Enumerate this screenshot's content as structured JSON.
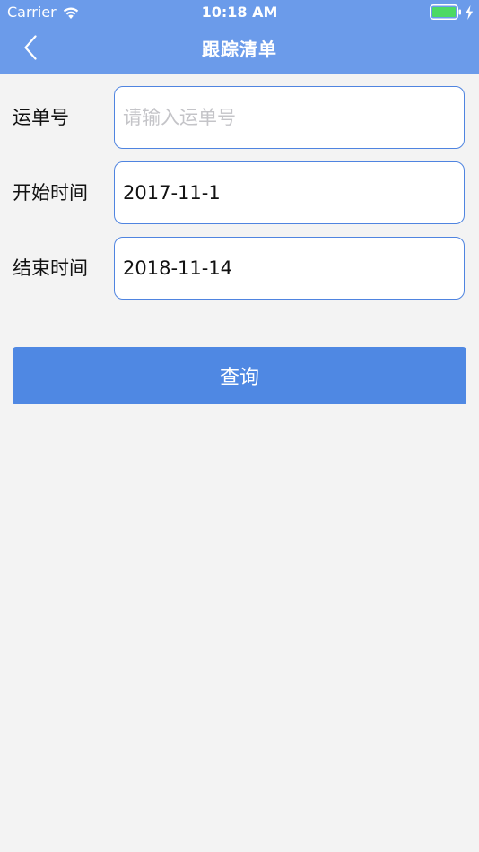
{
  "status_bar": {
    "carrier": "Carrier",
    "time": "10:18 AM",
    "wifi_icon": "wifi-icon",
    "battery_icon": "battery-icon",
    "charging_icon": "bolt-icon"
  },
  "nav": {
    "title": "跟踪清单",
    "back_icon": "chevron-left-icon"
  },
  "form": {
    "waybill": {
      "label": "运单号",
      "value": "",
      "placeholder": "请输入运单号"
    },
    "start_time": {
      "label": "开始时间",
      "value": "2017-11-1"
    },
    "end_time": {
      "label": "结束时间",
      "value": "2018-11-14"
    }
  },
  "query_button": {
    "label": "查询"
  },
  "colors": {
    "header_bg": "#6b9bea",
    "accent": "#4f88e3",
    "input_border": "#4f84e0",
    "page_bg": "#f3f3f3",
    "battery_fill": "#4cd964"
  }
}
